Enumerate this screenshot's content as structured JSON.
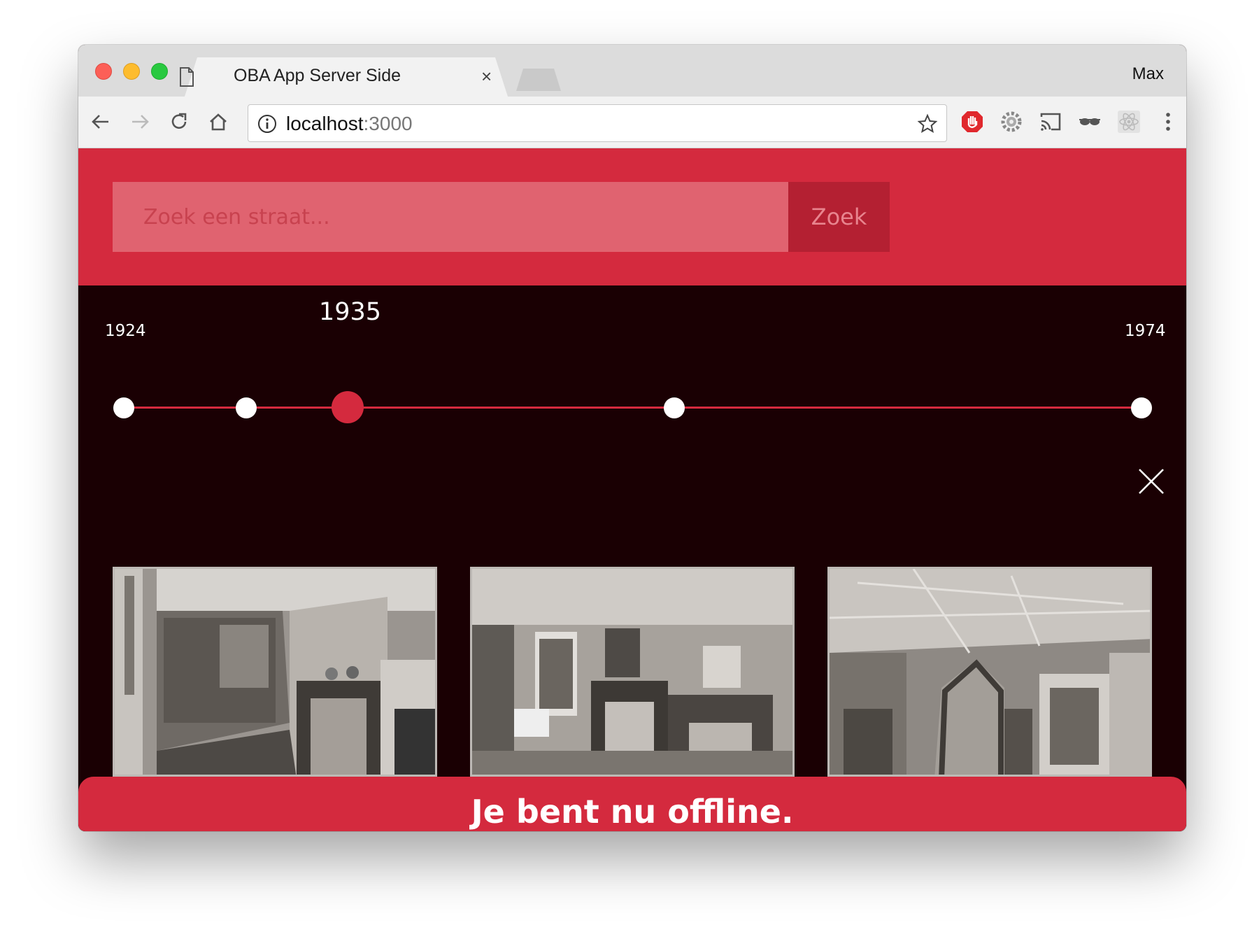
{
  "browser": {
    "tab_title": "OBA App Server Side",
    "tab_close": "×",
    "profile_name": "Max",
    "url_host": "localhost",
    "url_port": ":3000"
  },
  "search": {
    "placeholder": "Zoek een straat...",
    "button_label": "Zoek"
  },
  "timeline": {
    "start_year": "1924",
    "end_year": "1974",
    "selected_year": "1935",
    "points": [
      {
        "name": "timeline-point-1",
        "active": false
      },
      {
        "name": "timeline-point-2",
        "active": false
      },
      {
        "name": "timeline-point-selected",
        "active": true
      },
      {
        "name": "timeline-point-4",
        "active": false
      },
      {
        "name": "timeline-point-5",
        "active": false
      }
    ]
  },
  "photos": [
    {
      "name": "photo-interior-1"
    },
    {
      "name": "photo-interior-2"
    },
    {
      "name": "photo-interior-3"
    }
  ],
  "offline_banner": {
    "message": "Je bent nu offline."
  },
  "colors": {
    "brand_red": "#d42a3e",
    "dark_background": "#1a0003",
    "search_field": "#e06370",
    "search_button": "#b42032"
  }
}
